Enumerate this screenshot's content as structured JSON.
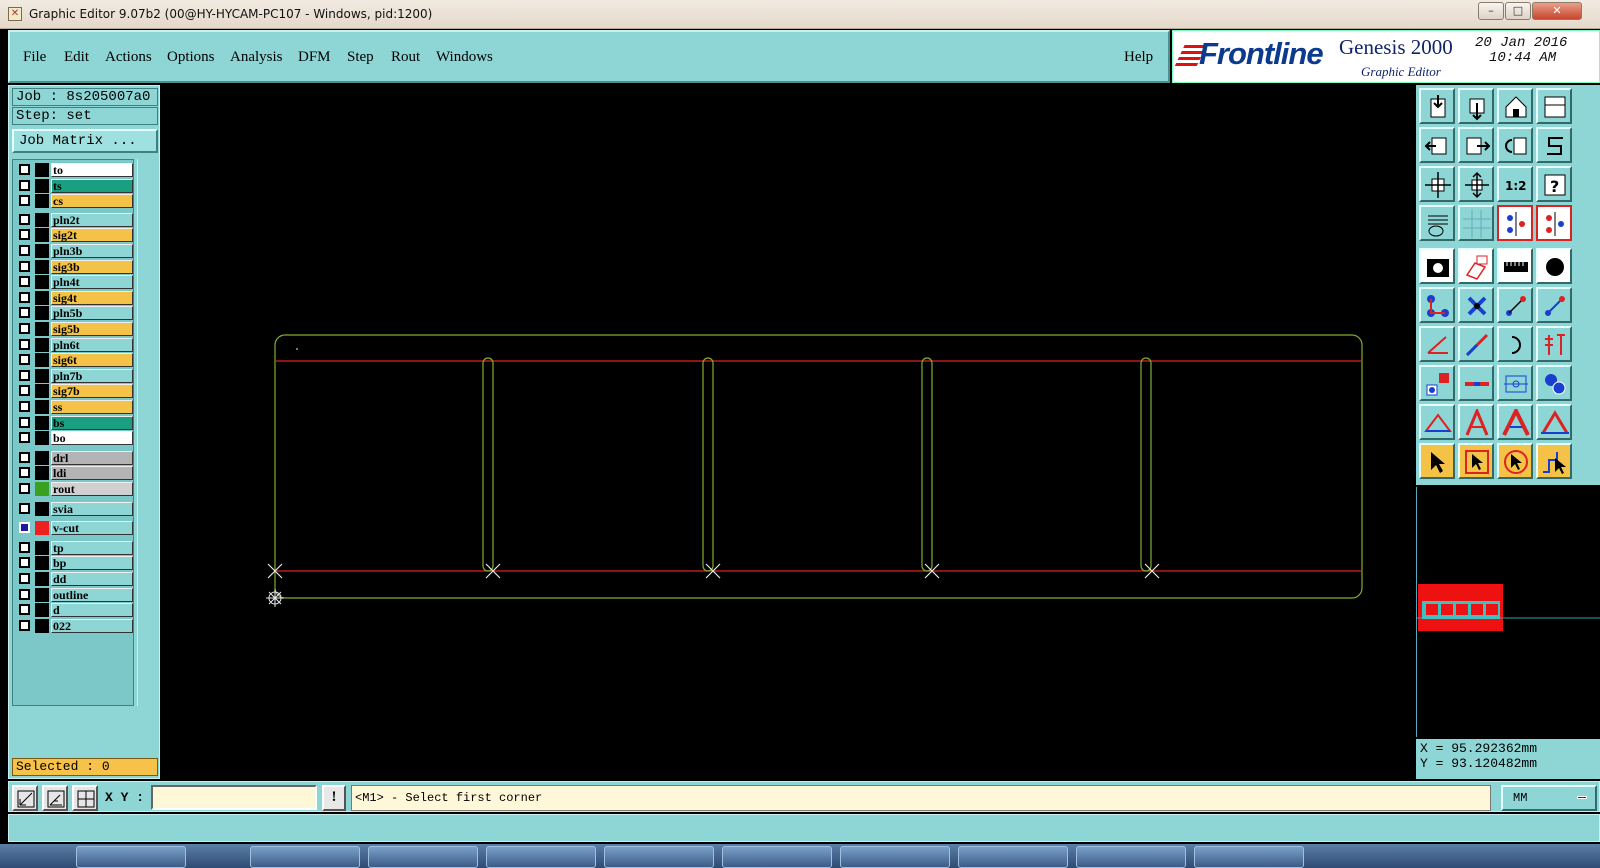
{
  "window": {
    "title": "Graphic Editor 9.07b2 (00@HY-HYCAM-PC107 - Windows, pid:1200)"
  },
  "menu": {
    "items": [
      {
        "label": "File"
      },
      {
        "label": "Edit"
      },
      {
        "label": "Actions"
      },
      {
        "label": "Options"
      },
      {
        "label": "Analysis"
      },
      {
        "label": "DFM"
      },
      {
        "label": "Step"
      },
      {
        "label": "Rout"
      },
      {
        "label": "Windows"
      }
    ],
    "help": "Help"
  },
  "logo": {
    "brand": "Frontline",
    "product": "Genesis 2000",
    "subtitle": "Graphic Editor",
    "date": "20 Jan 2016",
    "time": "10:44 AM"
  },
  "job": {
    "job_label": "Job : 8s205007a0",
    "step_label": "Step: set",
    "matrix_button": "Job Matrix ..."
  },
  "layers": [
    {
      "name": "to",
      "color": "#ffffff",
      "swatch": "#000000"
    },
    {
      "name": "ts",
      "color": "#1aa080",
      "swatch": "#000000"
    },
    {
      "name": "cs",
      "color": "#f5c248",
      "swatch": "#000000"
    },
    {
      "name": "pln2t",
      "color": "#8ed6d6",
      "swatch": "#000000"
    },
    {
      "name": "sig2t",
      "color": "#f5c248",
      "swatch": "#000000"
    },
    {
      "name": "pln3b",
      "color": "#8ed6d6",
      "swatch": "#000000"
    },
    {
      "name": "sig3b",
      "color": "#f5c248",
      "swatch": "#000000"
    },
    {
      "name": "pln4t",
      "color": "#8ed6d6",
      "swatch": "#000000"
    },
    {
      "name": "sig4t",
      "color": "#f5c248",
      "swatch": "#000000"
    },
    {
      "name": "pln5b",
      "color": "#8ed6d6",
      "swatch": "#000000"
    },
    {
      "name": "sig5b",
      "color": "#f5c248",
      "swatch": "#000000"
    },
    {
      "name": "pln6t",
      "color": "#8ed6d6",
      "swatch": "#000000"
    },
    {
      "name": "sig6t",
      "color": "#f5c248",
      "swatch": "#000000"
    },
    {
      "name": "pln7b",
      "color": "#8ed6d6",
      "swatch": "#000000"
    },
    {
      "name": "sig7b",
      "color": "#f5c248",
      "swatch": "#000000"
    },
    {
      "name": "ss",
      "color": "#f5c248",
      "swatch": "#000000"
    },
    {
      "name": "bs",
      "color": "#1aa080",
      "swatch": "#000000"
    },
    {
      "name": "bo",
      "color": "#ffffff",
      "swatch": "#000000"
    },
    {
      "name": "drl",
      "color": "#b4b4b4",
      "swatch": "#000000"
    },
    {
      "name": "ldi",
      "color": "#b4b4b4",
      "swatch": "#000000"
    },
    {
      "name": "rout",
      "color": "#d0d0d0",
      "swatch": "#3aa020"
    },
    {
      "name": "svia",
      "color": "#8ed6d6",
      "swatch": "#000000"
    },
    {
      "name": "v-cut",
      "color": "#8ed6d6",
      "swatch": "#ee2020"
    },
    {
      "name": "tp",
      "color": "#8ed6d6",
      "swatch": "#000000"
    },
    {
      "name": "bp",
      "color": "#8ed6d6",
      "swatch": "#000000"
    },
    {
      "name": "dd",
      "color": "#8ed6d6",
      "swatch": "#000000"
    },
    {
      "name": "outline",
      "color": "#8ed6d6",
      "swatch": "#000000"
    },
    {
      "name": "d",
      "color": "#8ed6d6",
      "swatch": "#000000"
    },
    {
      "name": "022",
      "color": "#8ed6d6",
      "swatch": "#000000"
    }
  ],
  "selected": "Selected : 0",
  "coords": {
    "x": "X = 95.292362mm",
    "y": "Y = 93.120482mm"
  },
  "command": {
    "xy_label": "X Y :",
    "xy_value": "",
    "prompt": "<M1> - Select first corner",
    "units": "MM"
  },
  "colors": {
    "panel": "#8ed6d6",
    "outline_layer": "#7fae32",
    "vcut_layer": "#e02020",
    "canvas": "#000000"
  }
}
